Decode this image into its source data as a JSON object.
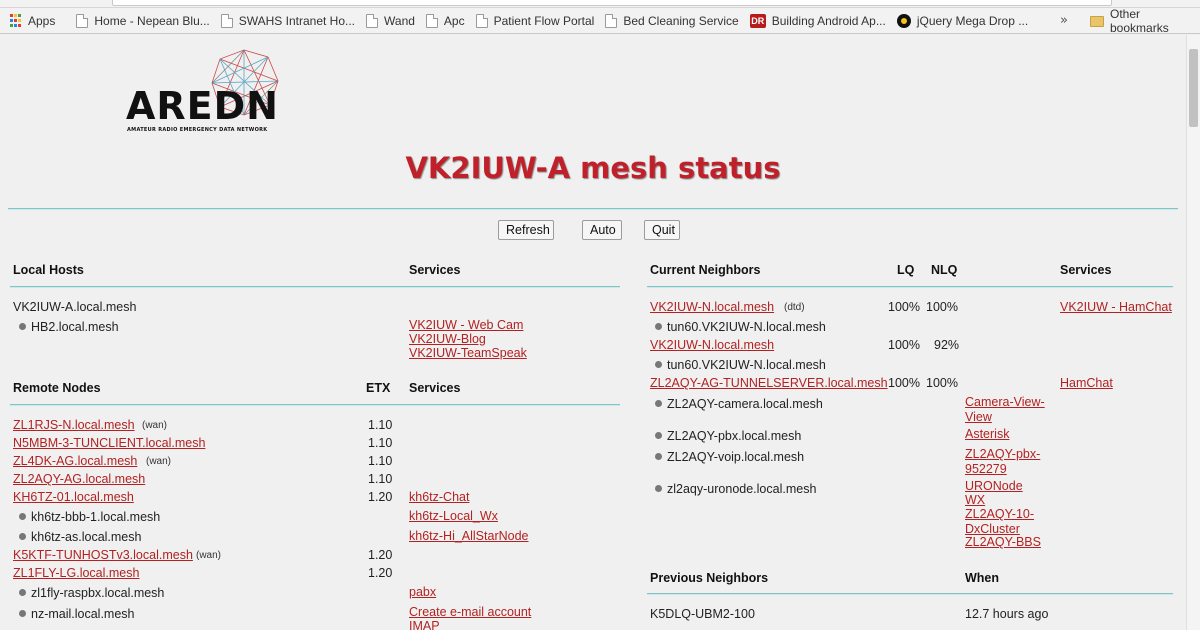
{
  "bookmarks": {
    "items": [
      {
        "label": "Apps",
        "icon": "apps-grid-icon"
      },
      {
        "label": "Home - Nepean Blu...",
        "icon": "page-icon"
      },
      {
        "label": "SWAHS Intranet Ho...",
        "icon": "page-icon"
      },
      {
        "label": "Wand",
        "icon": "page-icon"
      },
      {
        "label": "Apc",
        "icon": "page-icon"
      },
      {
        "label": "Patient Flow Portal",
        "icon": "page-icon"
      },
      {
        "label": "Bed Cleaning Service",
        "icon": "page-icon"
      },
      {
        "label": "Building Android Ap...",
        "icon": "dr-icon"
      },
      {
        "label": "jQuery Mega Drop ...",
        "icon": "jquery-icon"
      }
    ],
    "more": "»",
    "other": "Other bookmarks"
  },
  "logo": {
    "word": "AREDN",
    "tagline": "AMATEUR RADIO EMERGENCY DATA NETWORK"
  },
  "title": "VK2IUW-A mesh status",
  "buttons": {
    "refresh": "Refresh",
    "auto": "Auto",
    "quit": "Quit"
  },
  "local_hosts": {
    "header": "Local Hosts",
    "services_header": "Services",
    "host": "VK2IUW-A.local.mesh",
    "sub_host": "HB2.local.mesh",
    "services": [
      "VK2IUW - Web Cam",
      "VK2IUW-Blog",
      "VK2IUW-TeamSpeak"
    ]
  },
  "remote_nodes": {
    "header": "Remote Nodes",
    "etx_header": "ETX",
    "services_header": "Services",
    "rows": [
      {
        "name": "ZL1RJS-N.local.mesh",
        "tag": "(wan)",
        "etx": "1.10"
      },
      {
        "name": "N5MBM-3-TUNCLIENT.local.mesh",
        "tag": "",
        "etx": "1.10"
      },
      {
        "name": "ZL4DK-AG.local.mesh",
        "tag": "(wan)",
        "etx": "1.10"
      },
      {
        "name": "ZL2AQY-AG.local.mesh",
        "tag": "",
        "etx": "1.10"
      },
      {
        "name": "KH6TZ-01.local.mesh",
        "tag": "",
        "etx": "1.20",
        "service": "kh6tz-Chat"
      },
      {
        "sub": "kh6tz-bbb-1.local.mesh",
        "service": "kh6tz-Local_Wx"
      },
      {
        "sub": "kh6tz-as.local.mesh",
        "service": "kh6tz-Hi_AllStarNode"
      },
      {
        "name": "K5KTF-TUNHOSTv3.local.mesh",
        "tag": "(wan)",
        "etx": "1.20"
      },
      {
        "name": "ZL1FLY-LG.local.mesh",
        "tag": "",
        "etx": "1.20"
      },
      {
        "sub": "zl1fly-raspbx.local.mesh",
        "service": "pabx"
      },
      {
        "sub": "nz-mail.local.mesh",
        "service": "Create e-mail account",
        "service2": "IMAP"
      }
    ]
  },
  "current_neighbors": {
    "header": "Current Neighbors",
    "lq_header": "LQ",
    "nlq_header": "NLQ",
    "services_header": "Services",
    "rows": [
      {
        "name": "VK2IUW-N.local.mesh",
        "tag": "(dtd)",
        "lq": "100%",
        "nlq": "100%",
        "service": "VK2IUW - HamChat"
      },
      {
        "sub": "tun60.VK2IUW-N.local.mesh"
      },
      {
        "name": "VK2IUW-N.local.mesh",
        "lq": "100%",
        "nlq": "92%"
      },
      {
        "sub": "tun60.VK2IUW-N.local.mesh"
      },
      {
        "name": "ZL2AQY-AG-TUNNELSERVER.local.mesh",
        "lq": "100%",
        "nlq": "100%",
        "service": "HamChat"
      },
      {
        "sub": "ZL2AQY-camera.local.mesh",
        "service": "Camera-View-View"
      },
      {
        "sub": "ZL2AQY-pbx.local.mesh",
        "service": "Asterisk"
      },
      {
        "sub": "ZL2AQY-voip.local.mesh",
        "service": "ZL2AQY-pbx-952279"
      },
      {
        "sub": "zl2aqy-uronode.local.mesh",
        "services": [
          "URONode",
          "WX",
          "ZL2AQY-10-DxCluster",
          "ZL2AQY-BBS"
        ]
      }
    ]
  },
  "previous_neighbors": {
    "header": "Previous Neighbors",
    "when_header": "When",
    "rows": [
      {
        "name": "K5DLQ-UBM2-100",
        "when": "12.7 hours ago"
      }
    ]
  }
}
